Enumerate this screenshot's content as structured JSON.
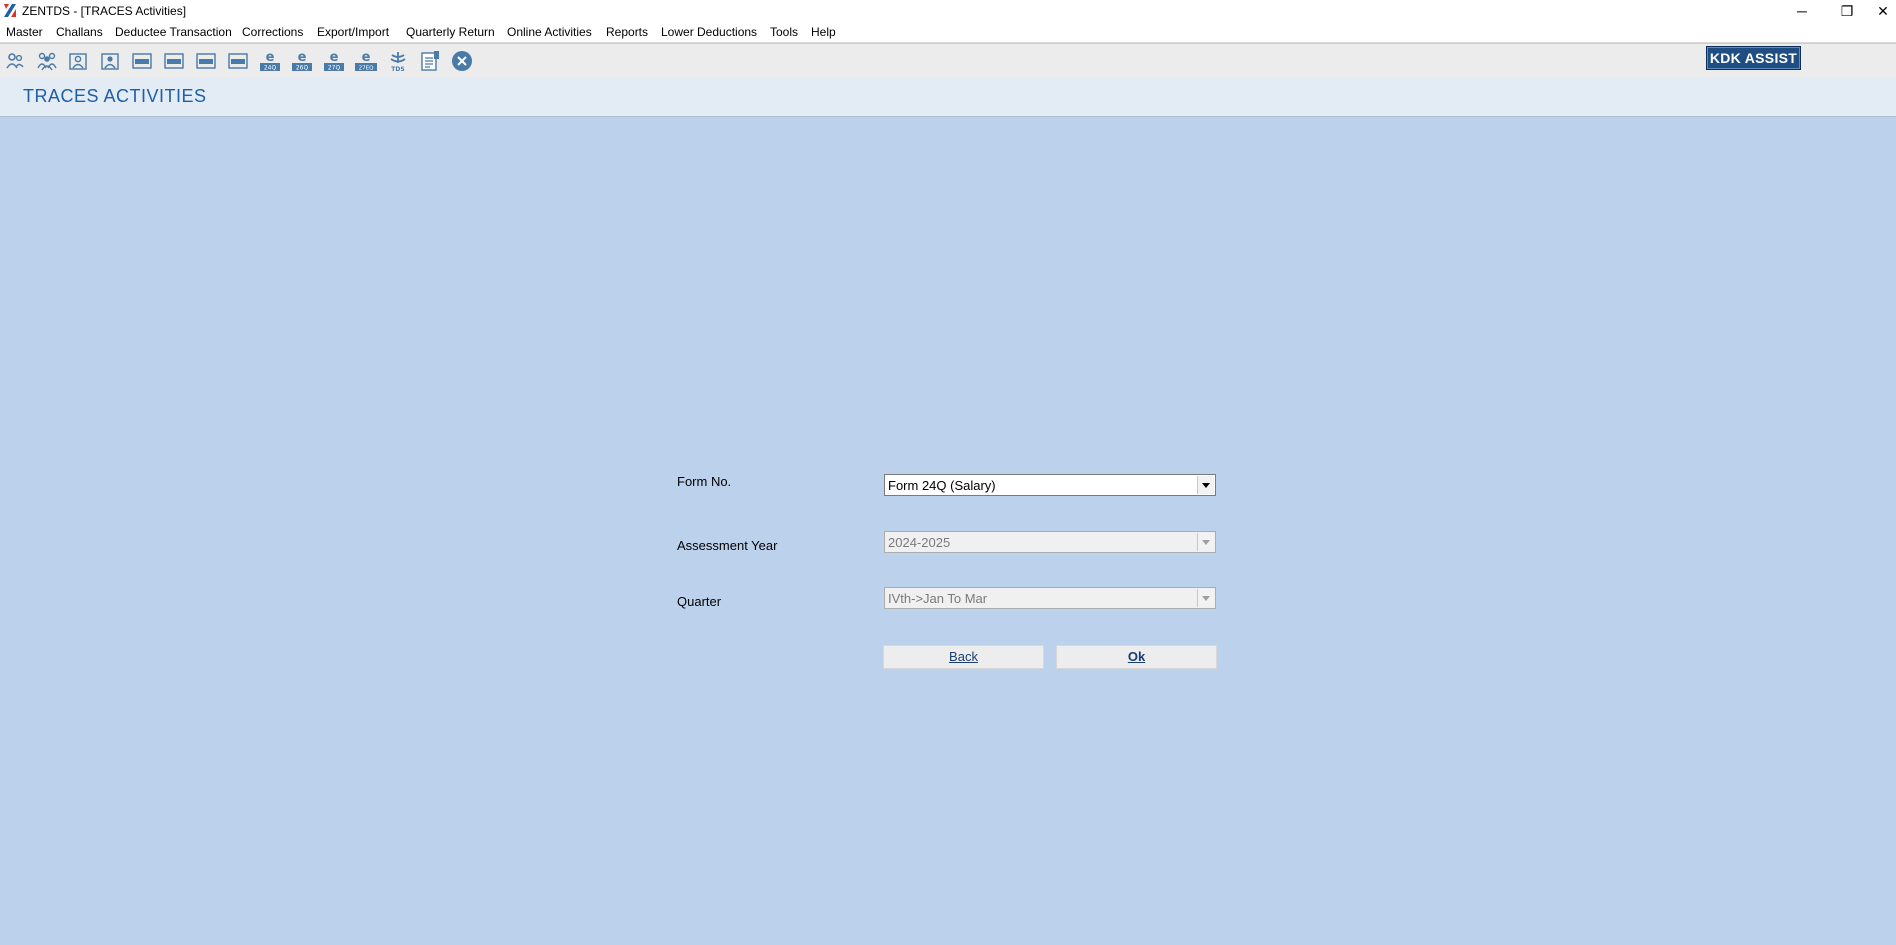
{
  "window": {
    "title": "ZENTDS - [TRACES Activities]",
    "controls": {
      "minimize": "─",
      "restore": "❐",
      "close": "✕"
    }
  },
  "menu": [
    {
      "label": "Master"
    },
    {
      "label": "Challans"
    },
    {
      "label": "Deductee Transaction"
    },
    {
      "label": "Corrections"
    },
    {
      "label": "Export/Import"
    },
    {
      "label": "Quarterly Return"
    },
    {
      "label": "Online Activities"
    },
    {
      "label": "Reports"
    },
    {
      "label": "Lower Deductions"
    },
    {
      "label": "Tools"
    },
    {
      "label": "Help"
    }
  ],
  "toolbar": {
    "icons": [
      "deductor-icon",
      "deductees-icon",
      "employee-icon",
      "employee-salary-icon",
      "form-24q-icon",
      "form-26q-icon",
      "form-27q-icon",
      "form-27eq-icon",
      "e-24q-icon",
      "e-26q-icon",
      "e-27q-icon",
      "e-27eq-icon",
      "tds-icon",
      "report-icon",
      "close-circle-icon"
    ],
    "e_labels": [
      "24Q",
      "26Q",
      "27Q",
      "27EQ"
    ],
    "box_labels": [
      "24Q",
      "26Q",
      "27Q",
      "27EQ"
    ],
    "tds_label": "TDS",
    "kdk_assist": "KDK ASSIST"
  },
  "page": {
    "title": "TRACES ACTIVITIES"
  },
  "form": {
    "form_no": {
      "label": "Form No.",
      "value": "Form 24Q (Salary)"
    },
    "assessment_year": {
      "label": "Assessment Year",
      "value": "2024-2025"
    },
    "quarter": {
      "label": "Quarter",
      "value": "IVth->Jan To Mar"
    },
    "back_button": "Back",
    "ok_button": "Ok"
  },
  "colors": {
    "background": "#bcd1eb",
    "title_blue": "#1e5fa8",
    "kdk_button": "#1f4f82",
    "icon_blue": "#4a7aa8"
  }
}
